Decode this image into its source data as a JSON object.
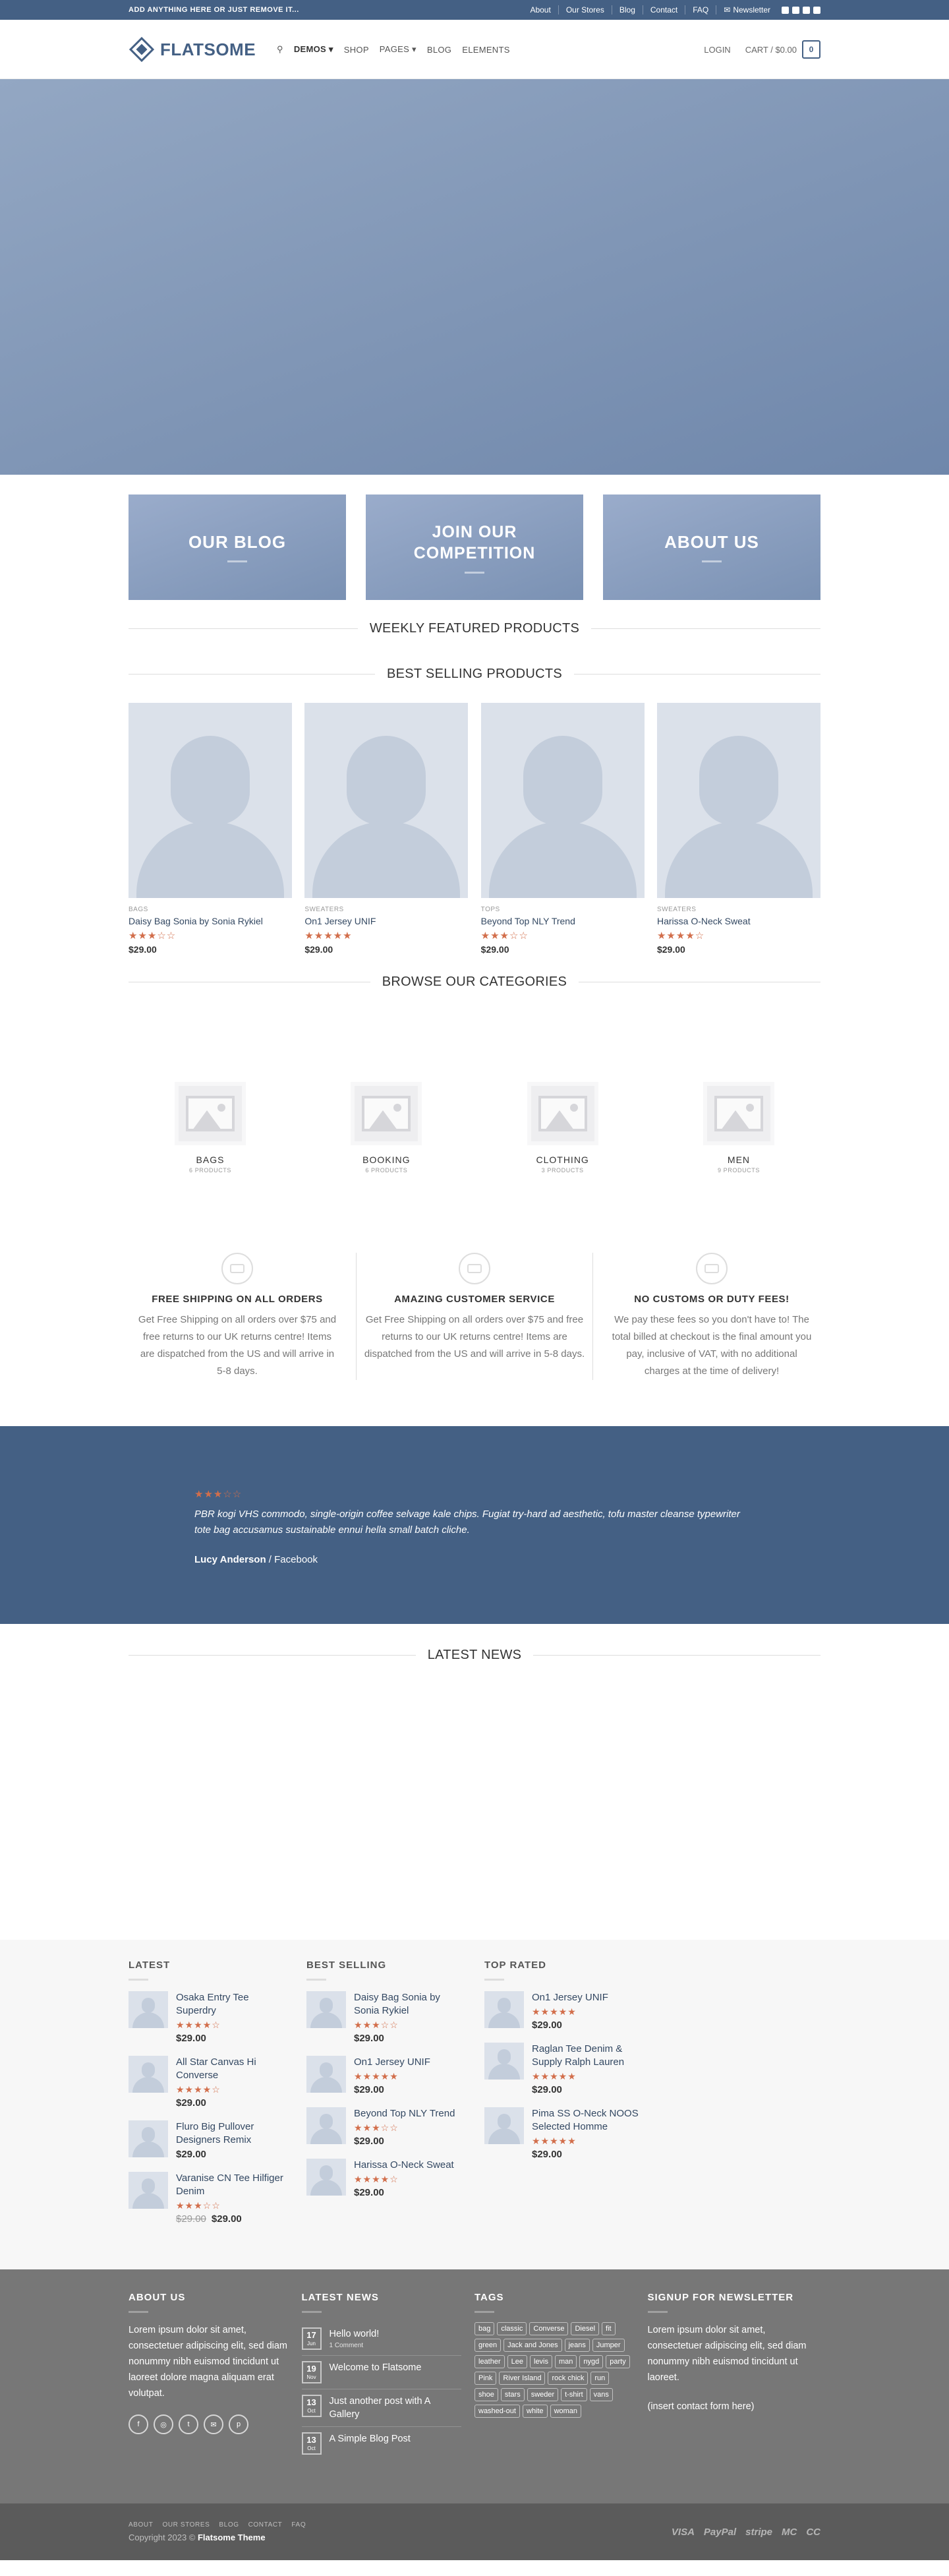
{
  "topbar": {
    "promo": "ADD ANYTHING HERE OR JUST REMOVE IT...",
    "links": [
      "About",
      "Our Stores",
      "Blog",
      "Contact",
      "FAQ"
    ],
    "newsletter": "Newsletter"
  },
  "header": {
    "logo": "FLATSOME",
    "nav": [
      "DEMOS",
      "SHOP",
      "PAGES",
      "BLOG",
      "ELEMENTS"
    ],
    "login": "LOGIN",
    "cart": "CART / $0.00",
    "cart_count": "0"
  },
  "banners": {
    "blog": "OUR BLOG",
    "competition_1": "JOIN OUR",
    "competition_2": "COMPETITION",
    "about": "ABOUT US"
  },
  "sections": {
    "weekly": "WEEKLY FEATURED PRODUCTS",
    "best": "BEST SELLING PRODUCTS",
    "browse": "BROWSE OUR CATEGORIES",
    "news": "LATEST NEWS"
  },
  "products": [
    {
      "cat": "BAGS",
      "name": "Daisy Bag Sonia by Sonia Rykiel",
      "stars": "★★★☆☆",
      "price": "$29.00"
    },
    {
      "cat": "SWEATERS",
      "name": "On1 Jersey UNIF",
      "stars": "★★★★★",
      "price": "$29.00"
    },
    {
      "cat": "TOPS",
      "name": "Beyond Top NLY Trend",
      "stars": "★★★☆☆",
      "price": "$29.00"
    },
    {
      "cat": "SWEATERS",
      "name": "Harissa O-Neck Sweat",
      "stars": "★★★★☆",
      "price": "$29.00"
    }
  ],
  "categories": [
    {
      "name": "BAGS",
      "count": "6 PRODUCTS"
    },
    {
      "name": "BOOKING",
      "count": "6 PRODUCTS"
    },
    {
      "name": "CLOTHING",
      "count": "3 PRODUCTS"
    },
    {
      "name": "MEN",
      "count": "9 PRODUCTS"
    }
  ],
  "features": [
    {
      "title": "FREE SHIPPING ON ALL ORDERS",
      "text": "Get Free Shipping on all orders over $75 and free returns to our UK returns centre! Items are dispatched from the US and will arrive in 5-8 days."
    },
    {
      "title": "AMAZING CUSTOMER SERVICE",
      "text": "Get Free Shipping on all orders over $75 and free returns to our UK returns centre! Items are dispatched from the US and will arrive in 5-8 days."
    },
    {
      "title": "NO CUSTOMS OR DUTY FEES!",
      "text": "We pay these fees so you don't have to! The total billed at checkout is the final amount you pay, inclusive of VAT, with no additional charges at the time of delivery!"
    }
  ],
  "testimonial": {
    "stars": "★★★☆☆",
    "quote": "PBR kogi VHS commodo, single-origin coffee selvage kale chips. Fugiat try-hard ad aesthetic, tofu master cleanse typewriter tote bag accusamus sustainable ennui hella small batch cliche.",
    "author": "Lucy Anderson",
    "source": " / Facebook"
  },
  "widgets": {
    "latest_title": "LATEST",
    "best_title": "BEST SELLING",
    "top_title": "TOP RATED",
    "latest": [
      {
        "name": "Osaka Entry Tee Superdry",
        "stars": "★★★★☆",
        "price": "$29.00",
        "old": ""
      },
      {
        "name": "All Star Canvas Hi Converse",
        "stars": "★★★★☆",
        "price": "$29.00",
        "old": ""
      },
      {
        "name": "Fluro Big Pullover Designers Remix",
        "stars": "",
        "price": "$29.00",
        "old": ""
      },
      {
        "name": "Varanise CN Tee Hilfiger Denim",
        "stars": "★★★☆☆",
        "price": "$29.00",
        "old": "$29.00"
      }
    ],
    "best": [
      {
        "name": "Daisy Bag Sonia by Sonia Rykiel",
        "stars": "★★★☆☆",
        "price": "$29.00"
      },
      {
        "name": "On1 Jersey UNIF",
        "stars": "★★★★★",
        "price": "$29.00"
      },
      {
        "name": "Beyond Top NLY Trend",
        "stars": "★★★☆☆",
        "price": "$29.00"
      },
      {
        "name": "Harissa O-Neck Sweat",
        "stars": "★★★★☆",
        "price": "$29.00"
      }
    ],
    "top": [
      {
        "name": "On1 Jersey UNIF",
        "stars": "★★★★★",
        "price": "$29.00"
      },
      {
        "name": "Raglan Tee Denim & Supply Ralph Lauren",
        "stars": "★★★★★",
        "price": "$29.00"
      },
      {
        "name": "Pima SS O-Neck NOOS Selected Homme",
        "stars": "★★★★★",
        "price": "$29.00"
      }
    ]
  },
  "footer": {
    "about_title": "ABOUT US",
    "about_text": "Lorem ipsum dolor sit amet, consectetuer adipiscing elit, sed diam nonummy nibh euismod tincidunt ut laoreet dolore magna aliquam erat volutpat.",
    "news_title": "LATEST NEWS",
    "news": [
      {
        "day": "17",
        "mon": "Jun",
        "title": "Hello world!",
        "comments": "1 Comment"
      },
      {
        "day": "19",
        "mon": "Nov",
        "title": "Welcome to Flatsome",
        "comments": ""
      },
      {
        "day": "13",
        "mon": "Oct",
        "title": "Just another post with A Gallery",
        "comments": ""
      },
      {
        "day": "13",
        "mon": "Oct",
        "title": "A Simple Blog Post",
        "comments": ""
      }
    ],
    "tags_title": "TAGS",
    "tags": [
      "bag",
      "classic",
      "Converse",
      "Diesel",
      "fit",
      "green",
      "Jack and Jones",
      "jeans",
      "Jumper",
      "leather",
      "Lee",
      "levis",
      "man",
      "nygd",
      "party",
      "Pink",
      "River Island",
      "rock chick",
      "run",
      "shoe",
      "stars",
      "sweder",
      "t-shirt",
      "vans",
      "washed-out",
      "white",
      "woman"
    ],
    "signup_title": "SIGNUP FOR NEWSLETTER",
    "signup_text": "Lorem ipsum dolor sit amet, consectetuer adipiscing elit, sed diam nonummy nibh euismod tincidunt ut laoreet.",
    "signup_form": "(insert contact form here)",
    "links": [
      "ABOUT",
      "OUR STORES",
      "BLOG",
      "CONTACT",
      "FAQ"
    ],
    "copyright": "Copyright 2023 © ",
    "copyright_brand": "Flatsome Theme",
    "payments": [
      "VISA",
      "PayPal",
      "stripe",
      "MC",
      "CC"
    ]
  }
}
